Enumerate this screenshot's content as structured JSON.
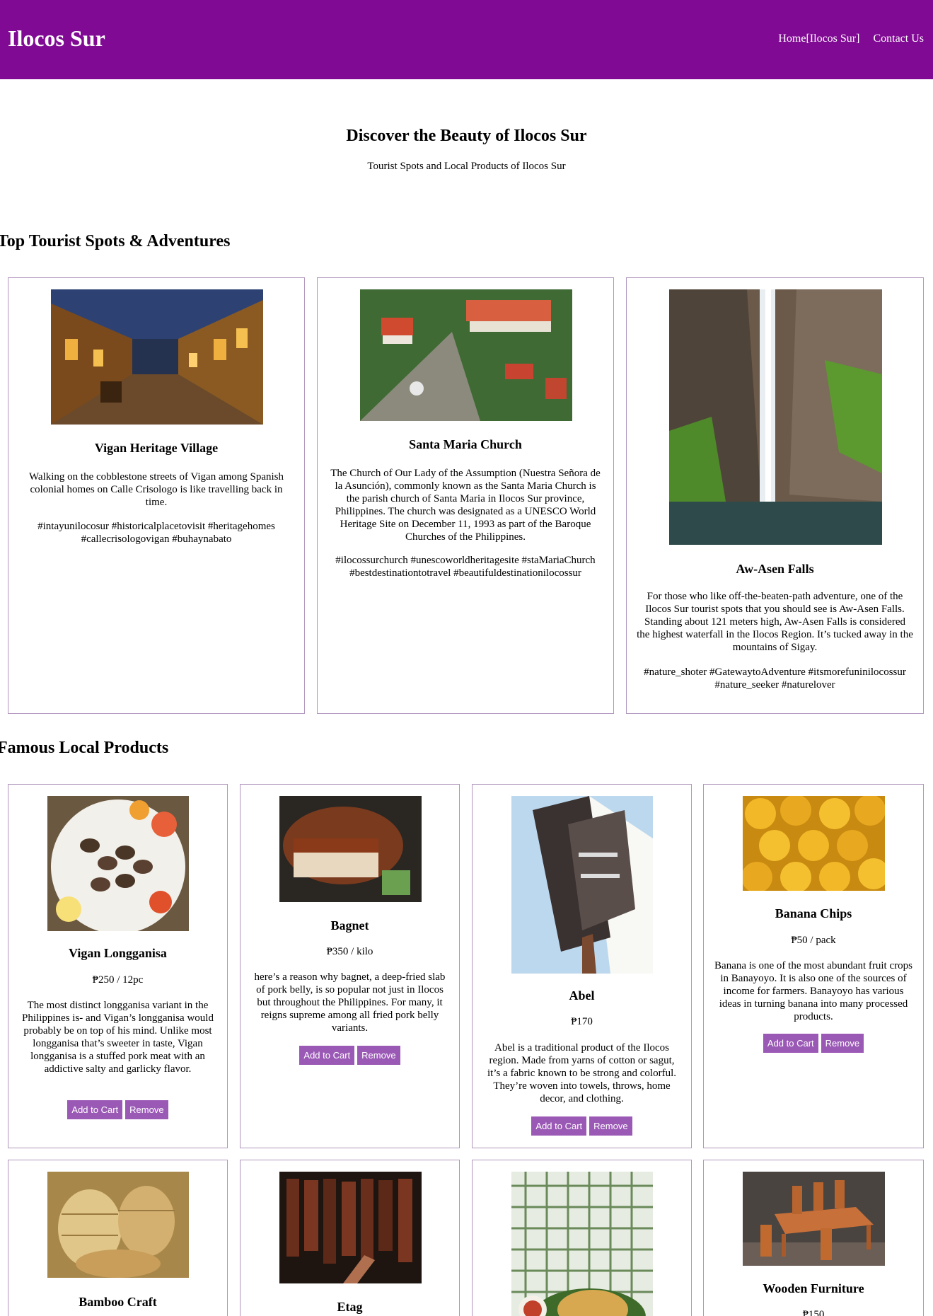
{
  "header": {
    "title": "Ilocos Sur",
    "nav": [
      "Home[Ilocos Sur]",
      "Contact Us"
    ]
  },
  "hero": {
    "title": "Discover the Beauty of Ilocos Sur",
    "subtitle": "Tourist Spots and Local Products of Ilocos Sur"
  },
  "spots": {
    "heading": "Top Tourist Spots & Adventures",
    "items": [
      {
        "name": "Vigan Heritage Village",
        "desc": "Walking on the cobblestone streets of Vigan among Spanish colonial homes on Calle Crisologo is like travelling back in time.",
        "tags": "#intayunilocosur #historicalplacetovisit #heritagehomes #callecrisologovigan #buhaynabato"
      },
      {
        "name": "Santa Maria Church",
        "desc": "The Church of Our Lady of the Assumption (Nuestra Señora de la Asunción), commonly known as the Santa Maria Church is the parish church of Santa Maria in Ilocos Sur province, Philippines. The church was designated as a UNESCO World Heritage Site on December 11, 1993 as part of the Baroque Churches of the Philippines.",
        "tags": "#ilocossurchurch #unescoworldheritagesite #staMariaChurch #bestdestinationtotravel #beautifuldestinationilocossur"
      },
      {
        "name": "Aw-Asen Falls",
        "desc": "For those who like off-the-beaten-path adventure, one of the Ilocos Sur tourist spots that you should see is Aw-Asen Falls. Standing about 121 meters high, Aw-Asen Falls is considered the highest waterfall in the Ilocos Region. It’s tucked away in the mountains of Sigay.",
        "tags": "#nature_shoter #GatewaytoAdventure #itsmorefuninilocossur #nature_seeker #naturelover"
      }
    ]
  },
  "products": {
    "heading": "Famous Local Products",
    "add_label": "Add to Cart",
    "remove_label": "Remove",
    "items": [
      {
        "name": "Vigan Longganisa",
        "price": "₱250 / 12pc",
        "desc": "The most distinct longganisa variant in the Philippines is- and Vigan’s longganisa would probably be on top of his mind. Unlike most longganisa that’s sweeter in taste, Vigan longganisa is a stuffed pork meat with an addictive salty and garlicky flavor."
      },
      {
        "name": "Bagnet",
        "price": "₱350 / kilo",
        "desc": "here’s a reason why bagnet, a deep-fried slab of pork belly, is so popular not just in Ilocos but throughout the Philippines. For many, it reigns supreme among all fried pork belly variants."
      },
      {
        "name": "Abel",
        "price": "₱170",
        "desc": "Abel is a traditional product of the Ilocos region. Made from yarns of cotton or sagut, it’s a fabric known to be strong and colorful. They’re woven into towels, throws, home decor, and clothing."
      },
      {
        "name": "Banana Chips",
        "price": "₱50 / pack",
        "desc": "Banana is one of the most abundant fruit crops in Banayoyo. It is also one of the sources of income for farmers. Banayoyo has various ideas in turning banana into many processed products."
      },
      {
        "name": "Bamboo Craft"
      },
      {
        "name": "Etag"
      },
      {
        "name": ""
      },
      {
        "name": "Wooden Furniture",
        "price": "₱150"
      }
    ]
  }
}
